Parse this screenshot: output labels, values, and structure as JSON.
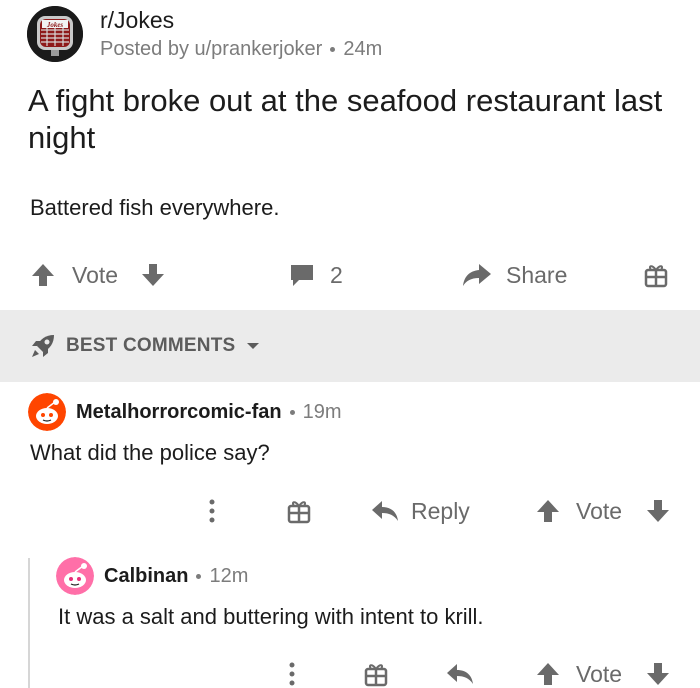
{
  "post": {
    "subreddit": "r/Jokes",
    "subreddit_avatar_text": "Jokes",
    "posted_by": "Posted by u/prankerjoker",
    "age": "24m",
    "title": "A fight broke out at the seafood restaurant last night",
    "body": "Battered fish everywhere.",
    "vote_label": "Vote",
    "comment_count": "2",
    "share_label": "Share"
  },
  "sort": {
    "label": "BEST COMMENTS"
  },
  "comments": [
    {
      "author": "Metalhorrorcomic-fan",
      "age": "19m",
      "text": "What did the police say?",
      "reply_label": "Reply",
      "vote_label": "Vote"
    },
    {
      "author": "Calbinan",
      "age": "12m",
      "text": "It was a salt and buttering with intent to krill.",
      "vote_label": "Vote"
    }
  ],
  "colors": {
    "accent_orange": "#ff4500",
    "icon_gray": "#6a6a6a",
    "sort_bar_bg": "#ebebeb"
  },
  "icons": [
    "upvote-icon",
    "downvote-icon",
    "comment-icon",
    "share-icon",
    "award-icon",
    "rocket-icon",
    "more-icon",
    "reply-icon"
  ]
}
